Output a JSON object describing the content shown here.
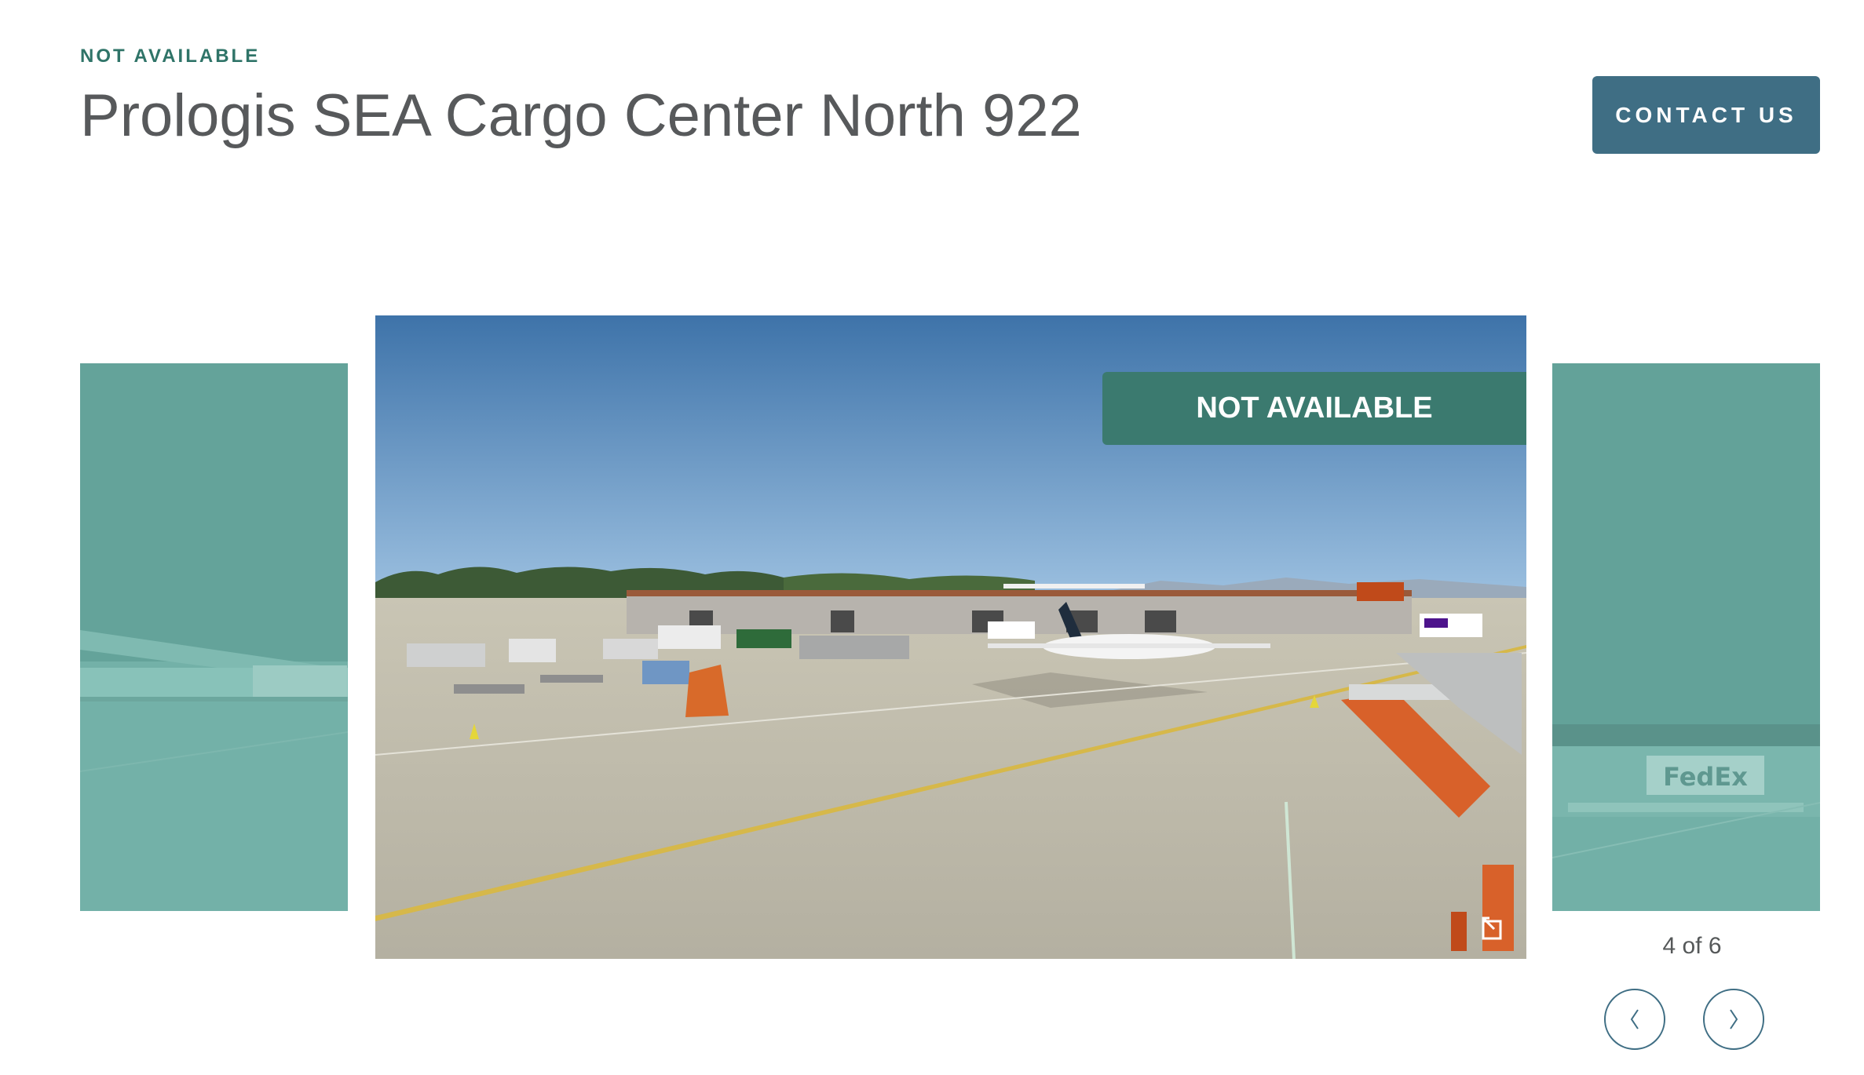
{
  "header": {
    "status_label": "NOT AVAILABLE",
    "title": "Prologis SEA Cargo Center North 922",
    "contact_label": "CONTACT US"
  },
  "gallery": {
    "banner_label": "NOT AVAILABLE",
    "counter": "4 of 6",
    "prev_icon": "chevron-left-icon",
    "next_icon": "chevron-right-icon",
    "expand_icon": "expand-icon",
    "side_logo_text": "FedEx"
  },
  "colors": {
    "accent_green": "#3b7a6f",
    "eyebrow_green": "#2f7468",
    "button_blue": "#3f6e84",
    "overlay_teal": "#6aa9a0",
    "title_gray": "#57595b"
  }
}
